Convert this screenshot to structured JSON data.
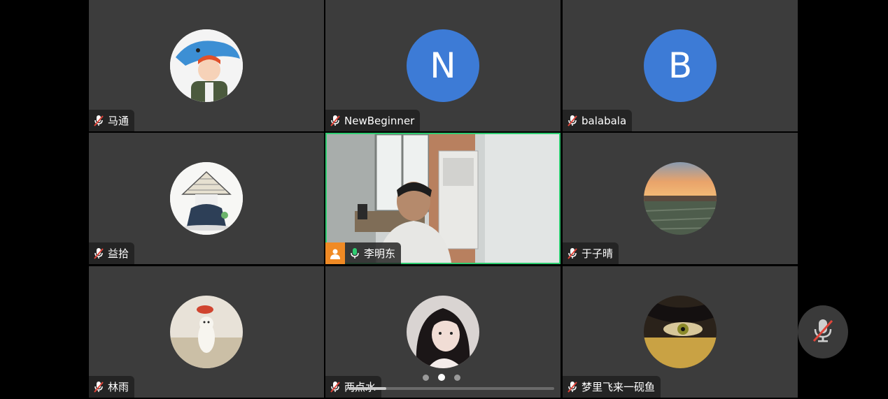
{
  "participants": [
    {
      "name": "马通",
      "avatar_type": "image",
      "avatar_icon": "cartoon-shark-hat-boy",
      "mic": "muted"
    },
    {
      "name": "NewBeginner",
      "avatar_type": "letter",
      "avatar_letter": "N",
      "mic": "muted"
    },
    {
      "name": "balabala",
      "avatar_type": "letter",
      "avatar_letter": "B",
      "mic": "muted"
    },
    {
      "name": "益拾",
      "avatar_type": "image",
      "avatar_icon": "cartoon-straw-hat-figure",
      "mic": "muted"
    },
    {
      "name": "李明东",
      "avatar_type": "video",
      "mic": "active",
      "is_host": true,
      "speaking": true
    },
    {
      "name": "于子晴",
      "avatar_type": "image",
      "avatar_icon": "sunset-field-photo",
      "mic": "muted"
    },
    {
      "name": "林雨",
      "avatar_type": "image",
      "avatar_icon": "hamster-photo",
      "mic": "muted"
    },
    {
      "name": "两点水",
      "avatar_type": "image",
      "avatar_icon": "girl-portrait-photo",
      "mic": "muted"
    },
    {
      "name": "梦里飞来一砚鱼",
      "avatar_type": "image",
      "avatar_icon": "eye-closeup-photo",
      "mic": "muted"
    }
  ],
  "pagination": {
    "pages": 3,
    "current": 2
  },
  "colors": {
    "tile_bg": "#3c3c3c",
    "letter_avatar": "#3d7bd6",
    "active_border": "#2ecc71",
    "host_badge": "#f08a24",
    "muted_slash": "#e0453a"
  },
  "floating_control": {
    "icon": "microphone-muted-icon"
  }
}
